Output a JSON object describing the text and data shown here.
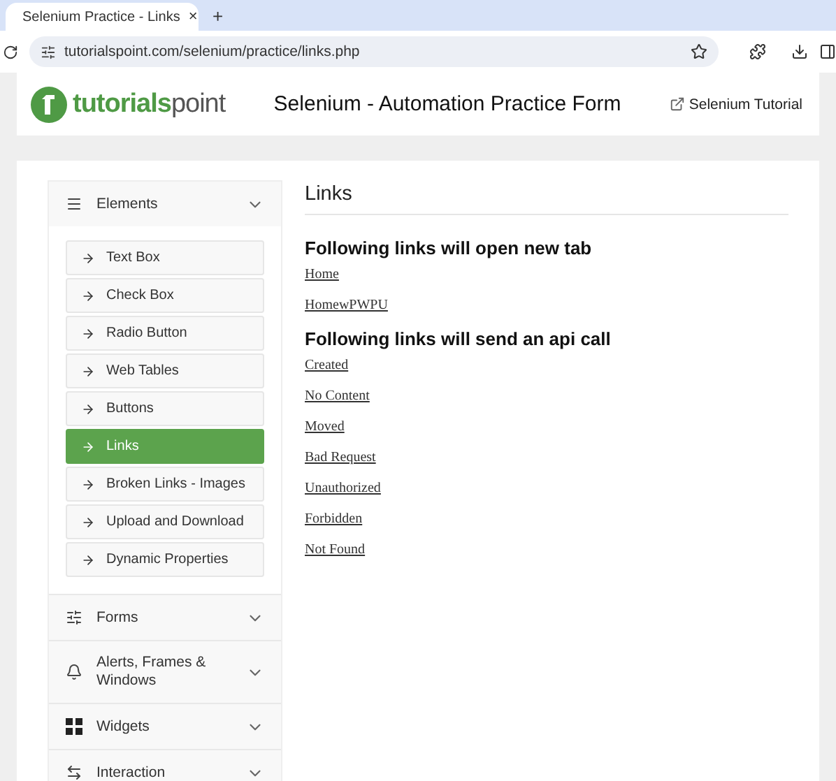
{
  "browser": {
    "tab": {
      "title": "Selenium Practice - Links",
      "close": "×"
    },
    "new_tab": "+",
    "url": "tutorialspoint.com/selenium/practice/links.php"
  },
  "header": {
    "logo_text": "**tutorials**point",
    "title": "Selenium - Automation Practice Form",
    "tutorial_link": "Selenium Tutorial"
  },
  "sidebar": {
    "sections": [
      {
        "label": "Elements",
        "kind": "menu",
        "items": [
          {
            "label": "Text Box",
            "selected": false
          },
          {
            "label": "Check Box",
            "selected": false
          },
          {
            "label": "Radio Button",
            "selected": false
          },
          {
            "label": "Web Tables",
            "selected": false
          },
          {
            "label": "Buttons",
            "selected": false
          },
          {
            "label": "Links",
            "selected": true
          },
          {
            "label": "Broken Links - Images",
            "selected": false
          },
          {
            "label": "Upload and Download",
            "selected": false
          },
          {
            "label": "Dynamic Properties",
            "selected": false
          }
        ]
      },
      {
        "label": "Forms",
        "kind": "form"
      },
      {
        "label": "Alerts, Frames & Windows",
        "kind": "bell"
      },
      {
        "label": "Widgets",
        "kind": "widgets"
      },
      {
        "label": "Interaction",
        "kind": "swap"
      }
    ]
  },
  "content": {
    "title": "Links",
    "groups": [
      {
        "heading": "Following links will open new tab",
        "links": [
          "Home",
          "HomewPWPU"
        ]
      },
      {
        "heading": "Following links will send an api call",
        "links": [
          "Created",
          "No Content",
          "Moved",
          "Bad Request",
          "Unauthorized",
          "Forbidden",
          "Not Found"
        ]
      }
    ]
  }
}
